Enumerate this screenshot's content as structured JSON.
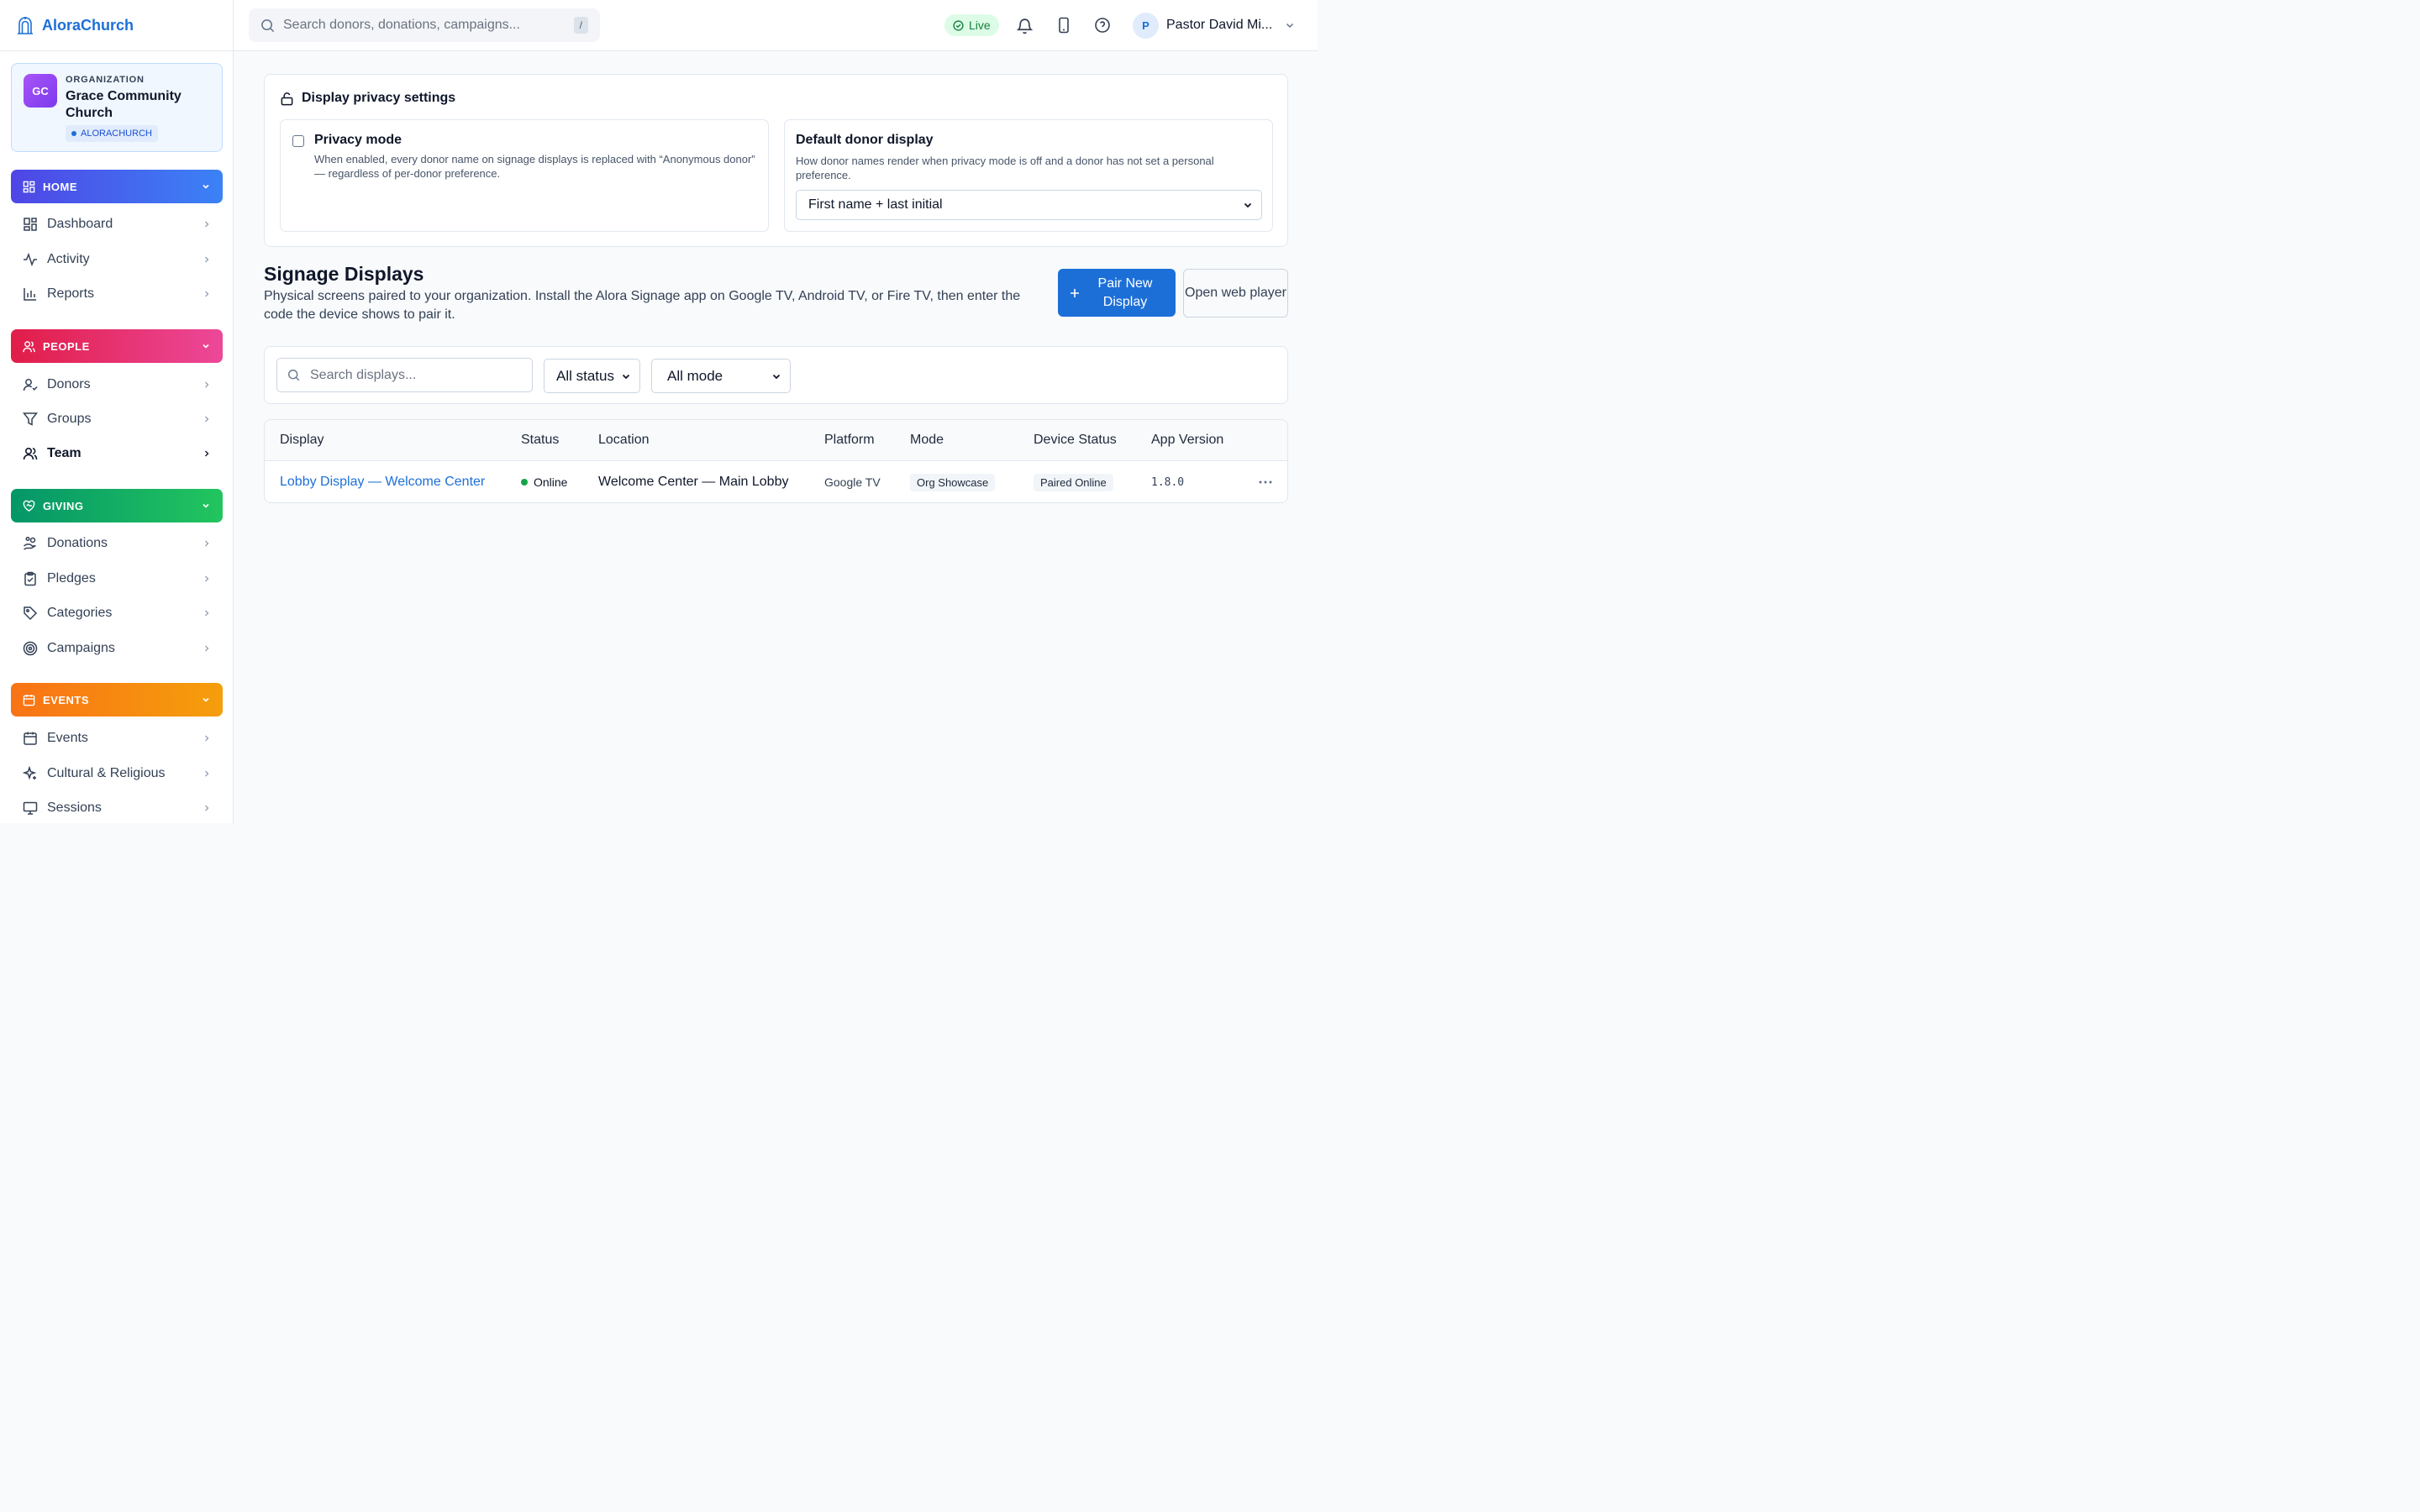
{
  "brand": {
    "name": "AloraChurch"
  },
  "organization": {
    "initials": "GC",
    "kicker": "ORGANIZATION",
    "name": "Grace Community Church",
    "badge": "ALORACHURCH"
  },
  "sidebar": {
    "sections": [
      {
        "label": "HOME",
        "items": [
          "Dashboard",
          "Activity",
          "Reports"
        ]
      },
      {
        "label": "PEOPLE",
        "items": [
          "Donors",
          "Groups",
          "Team"
        ]
      },
      {
        "label": "GIVING",
        "items": [
          "Donations",
          "Pledges",
          "Categories",
          "Campaigns"
        ]
      },
      {
        "label": "EVENTS",
        "items": [
          "Events",
          "Cultural & Religious",
          "Sessions"
        ]
      }
    ]
  },
  "topbar": {
    "search_placeholder": "Search donors, donations, campaigns...",
    "search_shortcut": "/",
    "live_label": "Live",
    "user_initial": "P",
    "user_name": "Pastor David Mi..."
  },
  "privacy": {
    "title": "Display privacy settings",
    "privacy_mode": {
      "title": "Privacy mode",
      "checked": false,
      "description": "When enabled, every donor name on signage displays is replaced with “Anonymous donor” — regardless of per-donor preference."
    },
    "default_display": {
      "title": "Default donor display",
      "description": "How donor names render when privacy mode is off and a donor has not set a personal preference.",
      "selected": "First name + last initial"
    }
  },
  "signage": {
    "title": "Signage Displays",
    "description": "Physical screens paired to your organization. Install the Alora Signage app on Google TV, Android TV, or Fire TV, then enter the code the device shows to pair it.",
    "pair_button": "Pair New Display",
    "web_player_button": "Open web player"
  },
  "filters": {
    "search_placeholder": "Search displays...",
    "status_selected": "All status",
    "mode_selected": "All mode"
  },
  "table": {
    "columns": [
      "Display",
      "Status",
      "Location",
      "Platform",
      "Mode",
      "Device Status",
      "App Version"
    ],
    "rows": [
      {
        "display": "Lobby Display — Welcome Center",
        "status": "Online",
        "location": "Welcome Center — Main Lobby",
        "platform": "Google TV",
        "mode": "Org Showcase",
        "device_status": "Paired Online",
        "app_version": "1.8.0"
      }
    ]
  },
  "colors": {
    "accent": "#1d6fd8",
    "online": "#16a34a"
  }
}
